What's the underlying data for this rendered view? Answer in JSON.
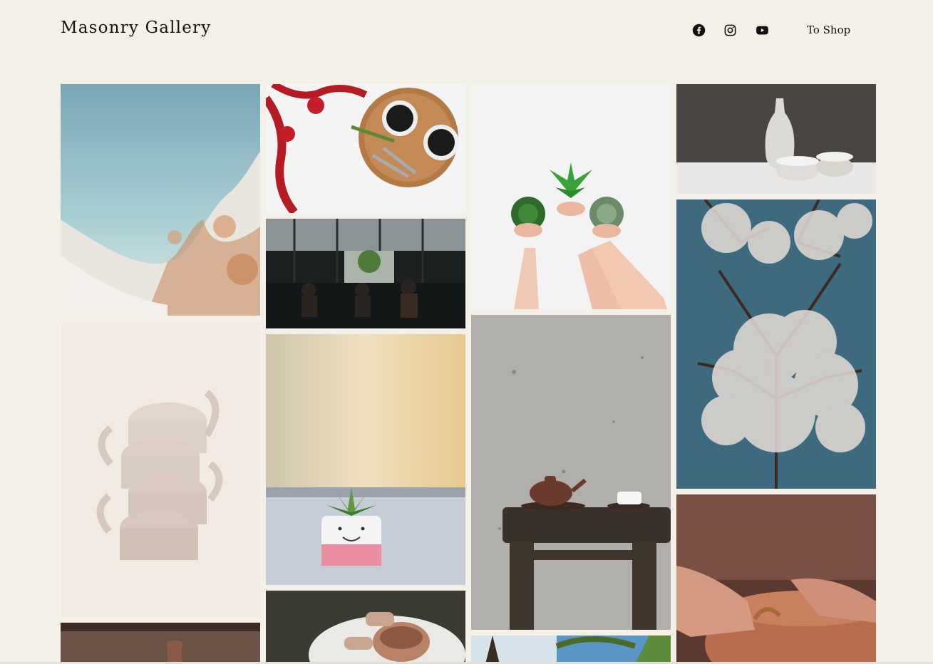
{
  "header": {
    "site_title": "Masonry Gallery",
    "shop_link": "To Shop",
    "social_icons": [
      "facebook-icon",
      "instagram-icon",
      "youtube-icon"
    ]
  },
  "gallery": {
    "columns": 4,
    "items": [
      {
        "subject": "aerial-coastline"
      },
      {
        "subject": "coffee-cups-christmas"
      },
      {
        "subject": "hands-holding-plants"
      },
      {
        "subject": "ceramic-vase-and-bowls"
      },
      {
        "subject": "cafe-interior"
      },
      {
        "subject": "snowy-tree-branches"
      },
      {
        "subject": "stacked-clay-cups"
      },
      {
        "subject": "succulent-smiley-pot"
      },
      {
        "subject": "teapot-on-stool"
      },
      {
        "subject": "pottery-carving-hands"
      },
      {
        "subject": "pottery-wheel"
      },
      {
        "subject": "palm-trees-sky"
      },
      {
        "subject": "clay-vase-partial"
      }
    ]
  },
  "colors": {
    "background": "#f4efe7",
    "text": "#111111"
  }
}
